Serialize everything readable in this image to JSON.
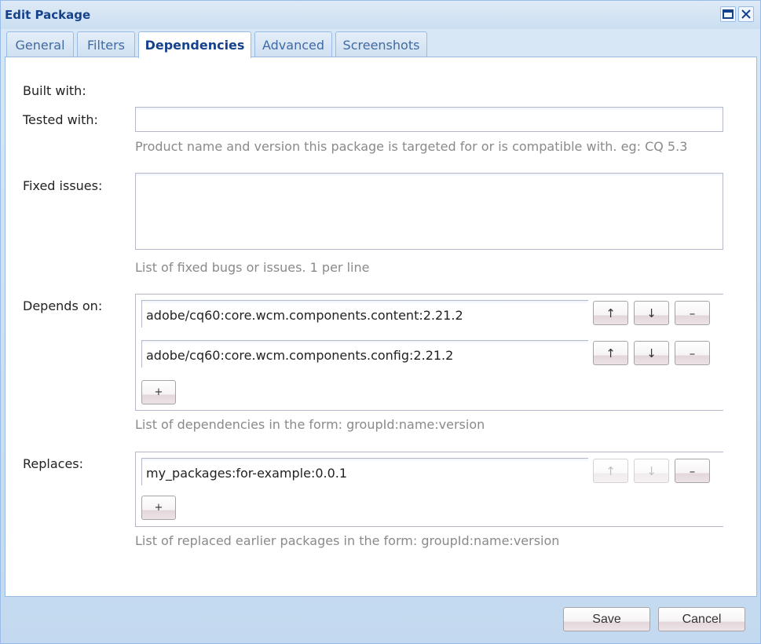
{
  "window": {
    "title": "Edit Package",
    "maximize_icon": "maximize-icon",
    "close_icon": "close-icon"
  },
  "tabs": [
    {
      "label": "General"
    },
    {
      "label": "Filters"
    },
    {
      "label": "Dependencies",
      "active": true
    },
    {
      "label": "Advanced"
    },
    {
      "label": "Screenshots"
    }
  ],
  "form": {
    "built_with": {
      "label": "Built with:"
    },
    "tested_with": {
      "label": "Tested with:",
      "value": "",
      "hint": "Product name and version this package is targeted for or is compatible with. eg: CQ 5.3"
    },
    "fixed_issues": {
      "label": "Fixed issues:",
      "value": "",
      "hint": "List of fixed bugs or issues. 1 per line"
    },
    "depends_on": {
      "label": "Depends on:",
      "items": [
        {
          "value": "adobe/cq60:core.wcm.components.content:2.21.2"
        },
        {
          "value": "adobe/cq60:core.wcm.components.config:2.21.2"
        }
      ],
      "hint": "List of dependencies in the form: groupId:name:version"
    },
    "replaces": {
      "label": "Replaces:",
      "items": [
        {
          "value": "my_packages:for-example:0.0.1"
        }
      ],
      "hint": "List of replaced earlier packages in the form: groupId:name:version"
    },
    "buttons": {
      "up": "↑",
      "down": "↓",
      "remove": "–",
      "add": "+"
    }
  },
  "footer": {
    "save_label": "Save",
    "cancel_label": "Cancel"
  }
}
